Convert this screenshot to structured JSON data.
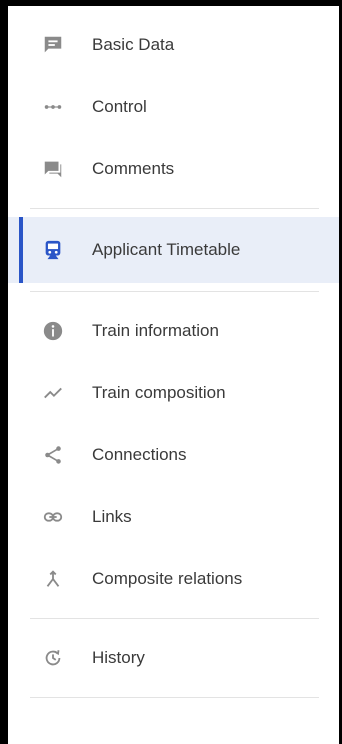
{
  "sidebar": {
    "colors": {
      "icon": "#8a8a8a",
      "active_icon": "#2a55c7",
      "active_bg": "#e9eef8",
      "text": "#3a3a3a"
    },
    "groups": [
      {
        "items": [
          {
            "label": "Basic Data",
            "icon": "comment-square-icon"
          },
          {
            "label": "Control",
            "icon": "dots-icon"
          },
          {
            "label": "Comments",
            "icon": "comments-icon"
          }
        ]
      },
      {
        "items": [
          {
            "label": "Applicant Timetable",
            "icon": "train-icon",
            "active": true
          }
        ]
      },
      {
        "items": [
          {
            "label": "Train information",
            "icon": "info-icon"
          },
          {
            "label": "Train composition",
            "icon": "trend-icon"
          },
          {
            "label": "Connections",
            "icon": "share-icon"
          },
          {
            "label": "Links",
            "icon": "link-icon"
          },
          {
            "label": "Composite relations",
            "icon": "merge-icon"
          }
        ]
      },
      {
        "items": [
          {
            "label": "History",
            "icon": "history-icon"
          }
        ]
      }
    ]
  }
}
